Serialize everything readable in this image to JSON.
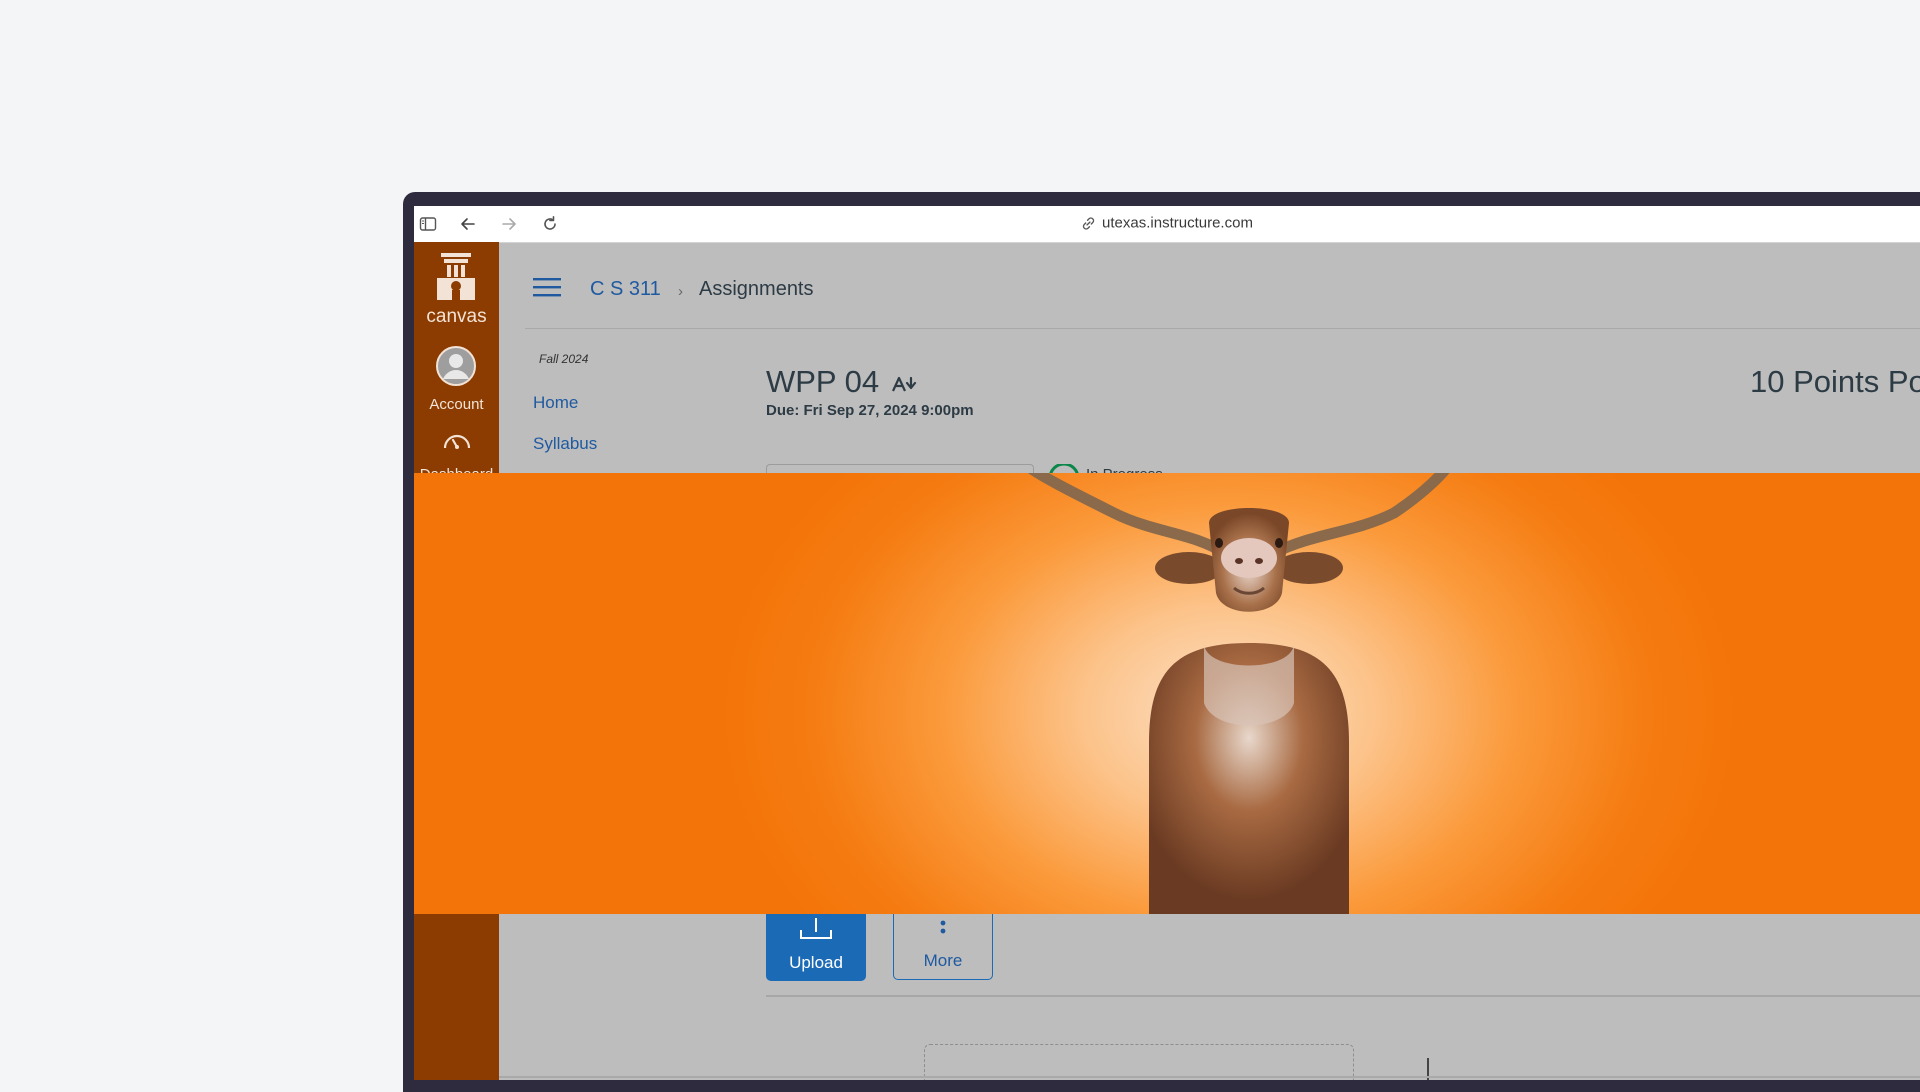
{
  "browser": {
    "url": "utexas.instructure.com"
  },
  "sidebar": {
    "logo_label": "canvas",
    "items": [
      {
        "label": "Account"
      },
      {
        "label": "Dashboard"
      }
    ]
  },
  "header": {
    "breadcrumb": [
      "C S 311",
      "Assignments"
    ],
    "separator": "›"
  },
  "course_nav": {
    "term": "Fall 2024",
    "links": [
      "Home",
      "Syllabus"
    ]
  },
  "assignment": {
    "title": "WPP 04",
    "due": "Due: Fri Sep 27, 2024 9:00pm",
    "points": "10 Points Po",
    "status": "In Progress"
  },
  "actions": {
    "upload_label": "Upload",
    "more_label": "More"
  },
  "colors": {
    "sidebar": "#8c3c00",
    "accent_blue": "#1a6ab6",
    "banner_orange": "#f37408"
  },
  "icons": [
    "sidebar-toggle-icon",
    "back-icon",
    "forward-icon",
    "reload-icon",
    "link-icon",
    "hamburger-icon",
    "canvas-logo-icon",
    "account-avatar-icon",
    "dashboard-gauge-icon",
    "immersive-reader-icon",
    "upload-icon",
    "more-vertical-icon"
  ]
}
